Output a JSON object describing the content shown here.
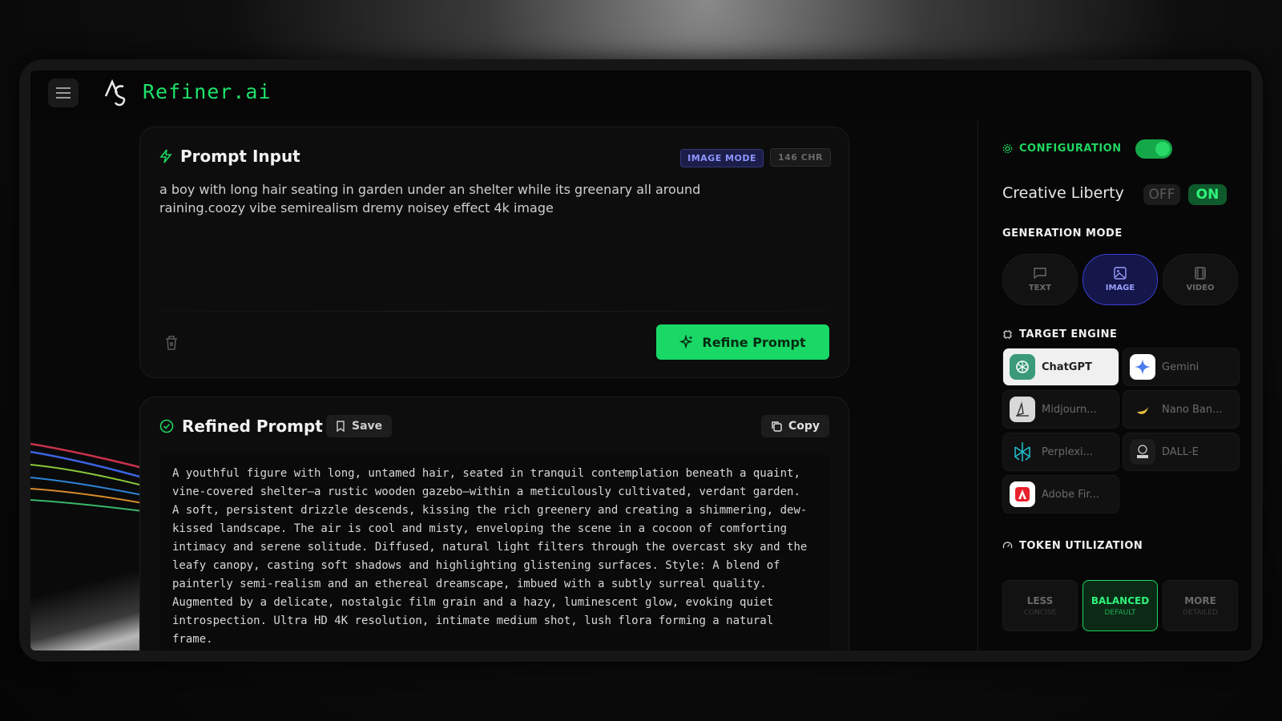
{
  "app": {
    "name": "Refiner.ai"
  },
  "prompt_input": {
    "title": "Prompt Input",
    "mode_badge": "IMAGE MODE",
    "char_count": "146 CHR",
    "text": "a boy with long hair seating in garden under an shelter while its greenary all around raining.coozy vibe semirealism dremy noisey effect 4k image",
    "refine_label": "Refine Prompt"
  },
  "refined_prompt": {
    "title": "Refined Prompt",
    "save_label": "Save",
    "copy_label": "Copy",
    "text": "A youthful figure with long, untamed hair, seated in tranquil contemplation beneath a quaint, vine-covered shelter—a rustic wooden gazebo—within a meticulously cultivated, verdant garden. A soft, persistent drizzle descends, kissing the rich greenery and creating a shimmering, dew-kissed landscape. The air is cool and misty, enveloping the scene in a cocoon of comforting intimacy and serene solitude. Diffused, natural light filters through the overcast sky and the leafy canopy, casting soft shadows and highlighting glistening surfaces. Style: A blend of painterly semi-realism and an ethereal dreamscape, imbued with a subtly surreal quality. Augmented by a delicate, nostalgic film grain and a hazy, luminescent glow, evoking quiet introspection. Ultra HD 4K resolution, intimate medium shot, lush flora forming a natural frame."
  },
  "sidebar": {
    "config_title": "CONFIGURATION",
    "config_enabled": true,
    "creative_liberty": {
      "label": "Creative Liberty",
      "off": "OFF",
      "on": "ON"
    },
    "generation_mode": {
      "title": "GENERATION MODE",
      "modes": [
        {
          "label": "TEXT",
          "icon": "message-icon",
          "active": false
        },
        {
          "label": "IMAGE",
          "icon": "image-icon",
          "active": true
        },
        {
          "label": "VIDEO",
          "icon": "film-icon",
          "active": false
        }
      ]
    },
    "target_engine": {
      "title": "TARGET ENGINE",
      "engines": [
        {
          "label": "ChatGPT",
          "active": true
        },
        {
          "label": "Gemini",
          "active": false
        },
        {
          "label": "Midjourn...",
          "active": false
        },
        {
          "label": "Nano Ban...",
          "active": false
        },
        {
          "label": "Perplexi...",
          "active": false
        },
        {
          "label": "DALL-E",
          "active": false
        },
        {
          "label": "Adobe Fir...",
          "active": false
        }
      ]
    },
    "token_utilization": {
      "title": "TOKEN UTILIZATION",
      "options": [
        {
          "label": "LESS",
          "sub": "CONCISE",
          "active": false
        },
        {
          "label": "BALANCED",
          "sub": "DEFAULT",
          "active": true
        },
        {
          "label": "MORE",
          "sub": "DETAILED",
          "active": false
        }
      ]
    }
  },
  "colors": {
    "accent": "#1ed760",
    "image_mode": "#3b40d0",
    "background": "#060606"
  }
}
